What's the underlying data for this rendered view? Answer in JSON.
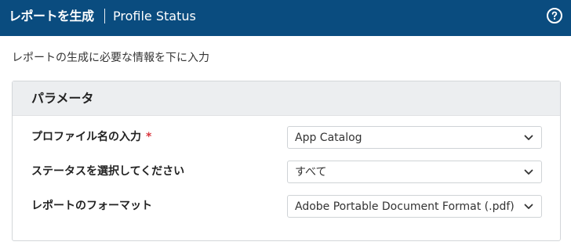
{
  "header": {
    "title": "レポートを生成",
    "subtitle": "Profile Status",
    "help_icon": "help-circle-icon"
  },
  "page": {
    "description": "レポートの生成に必要な情報を下に入力"
  },
  "panel": {
    "title": "パラメータ",
    "fields": [
      {
        "label": "プロファイル名の入力",
        "required_mark": "*",
        "value": "App Catalog",
        "icon": "chevron-down-icon"
      },
      {
        "label": "ステータスを選択してください",
        "value": "すべて",
        "icon": "chevron-down-icon"
      },
      {
        "label": "レポートのフォーマット",
        "value": "Adobe Portable Document Format (.pdf)",
        "icon": "chevron-down-icon"
      }
    ]
  },
  "colors": {
    "header_bg": "#0a4c7f",
    "panel_header_bg": "#eceef0",
    "required": "#d9363e"
  }
}
